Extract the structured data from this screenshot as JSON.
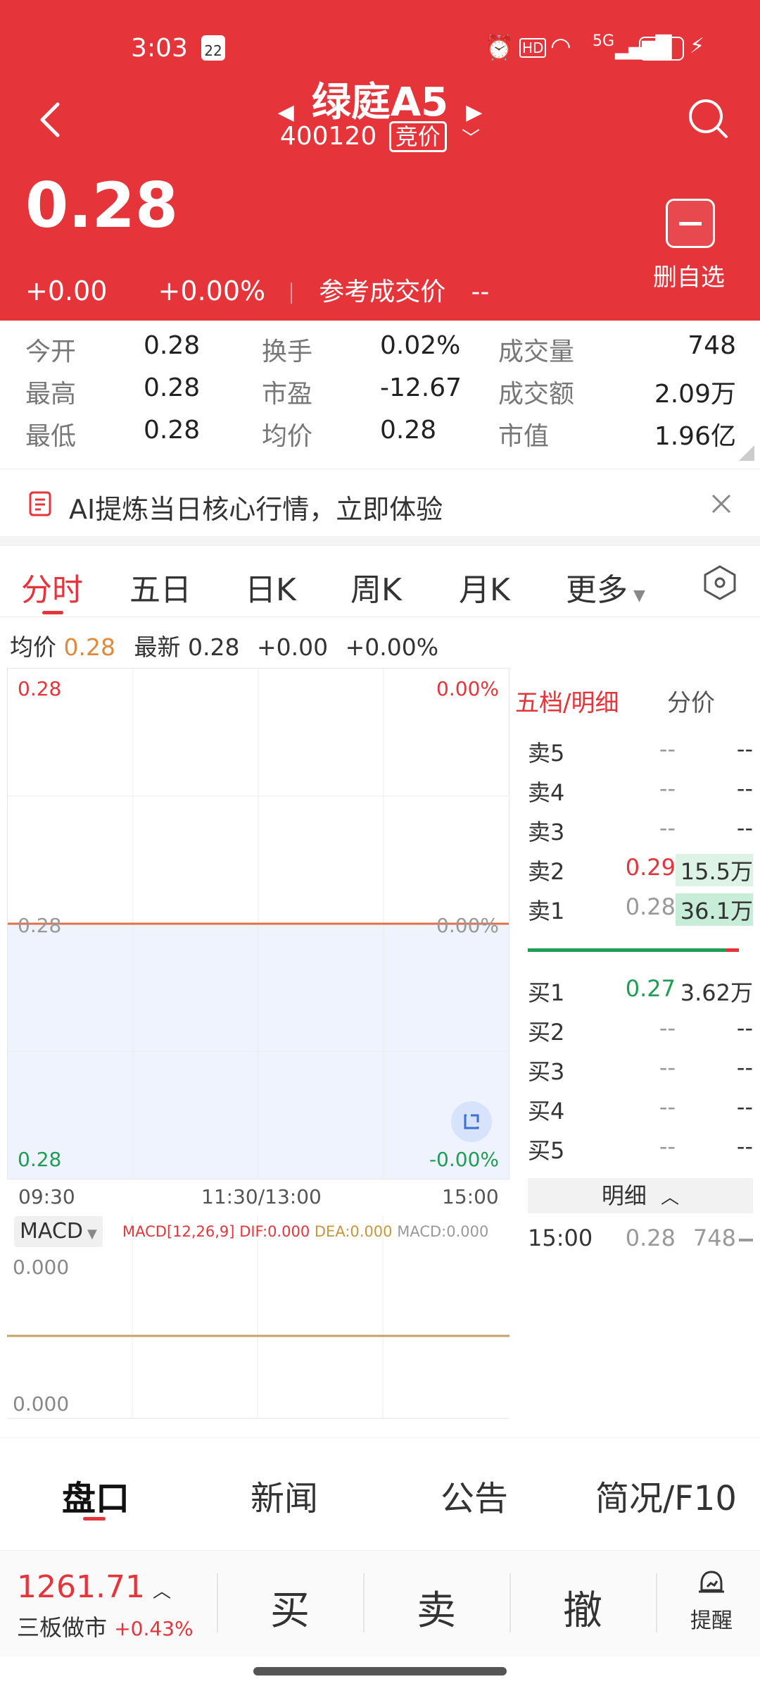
{
  "status": {
    "time": "3:03",
    "calendar_day": "22",
    "battery": "55",
    "network": "5G"
  },
  "header": {
    "back_label": "back",
    "stock_name": "绿庭A5",
    "stock_code": "400120",
    "badge": "竞价",
    "price": "0.28",
    "change": "+0.00",
    "change_pct": "+0.00%",
    "ref_label": "参考成交价",
    "ref_value": "--",
    "delete_label": "删自选"
  },
  "stats": [
    [
      {
        "l": "今开",
        "v": "0.28"
      },
      {
        "l": "换手",
        "v": "0.02%"
      },
      {
        "l": "成交量",
        "v": "748"
      }
    ],
    [
      {
        "l": "最高",
        "v": "0.28"
      },
      {
        "l": "市盈",
        "v": "-12.67"
      },
      {
        "l": "成交额",
        "v": "2.09万"
      }
    ],
    [
      {
        "l": "最低",
        "v": "0.28"
      },
      {
        "l": "均价",
        "v": "0.28"
      },
      {
        "l": "市值",
        "v": "1.96亿"
      }
    ]
  ],
  "ai_banner": {
    "text": "AI提炼当日核心行情，立即体验"
  },
  "tabs": [
    "分时",
    "五日",
    "日K",
    "周K",
    "月K",
    "更多"
  ],
  "summary": {
    "avg_label": "均价",
    "avg_value": "0.28",
    "latest_label": "最新",
    "latest_value": "0.28",
    "change": "+0.00",
    "pct": "+0.00%"
  },
  "chart": {
    "y_top": "0.28",
    "pct_top": "0.00%",
    "y_mid": "0.28",
    "pct_mid": "0.00%",
    "y_bot": "0.28",
    "pct_bot": "-0.00%",
    "x_start": "09:30",
    "x_mid": "11:30/13:00",
    "x_end": "15:00",
    "price_line": 0.28
  },
  "macd": {
    "selector": "MACD",
    "params": "MACD[12,26,9]",
    "dif": "DIF:0.000",
    "dea": "DEA:0.000",
    "macd": "MACD:0.000",
    "y_top": "0.000",
    "y_bot": "0.000"
  },
  "orderbook": {
    "tab_active": "五档/明细",
    "tab_other": "分价",
    "asks": [
      {
        "n": "卖5",
        "p": "--",
        "v": "--"
      },
      {
        "n": "卖4",
        "p": "--",
        "v": "--"
      },
      {
        "n": "卖3",
        "p": "--",
        "v": "--"
      },
      {
        "n": "卖2",
        "p": "0.29",
        "v": "15.5万"
      },
      {
        "n": "卖1",
        "p": "0.28",
        "v": "36.1万"
      }
    ],
    "bids": [
      {
        "n": "买1",
        "p": "0.27",
        "v": "3.62万"
      },
      {
        "n": "买2",
        "p": "--",
        "v": "--"
      },
      {
        "n": "买3",
        "p": "--",
        "v": "--"
      },
      {
        "n": "买4",
        "p": "--",
        "v": "--"
      },
      {
        "n": "买5",
        "p": "--",
        "v": "--"
      }
    ],
    "detail_label": "明细",
    "detail_row": {
      "time": "15:00",
      "price": "0.28",
      "vol": "748"
    }
  },
  "bottom_nav": [
    "盘口",
    "新闻",
    "公告",
    "简况/F10"
  ],
  "market": {
    "index_value": "1261.71",
    "index_name": "三板做市",
    "index_pct": "+0.43%"
  },
  "trade": {
    "buy": "买",
    "sell": "卖",
    "cancel": "撤",
    "alert": "提醒"
  },
  "colors": {
    "accent": "#e5353a",
    "up": "#e5353a",
    "down": "#1f9d55",
    "avg": "#e08a3c",
    "fill": "#eef3fd"
  }
}
